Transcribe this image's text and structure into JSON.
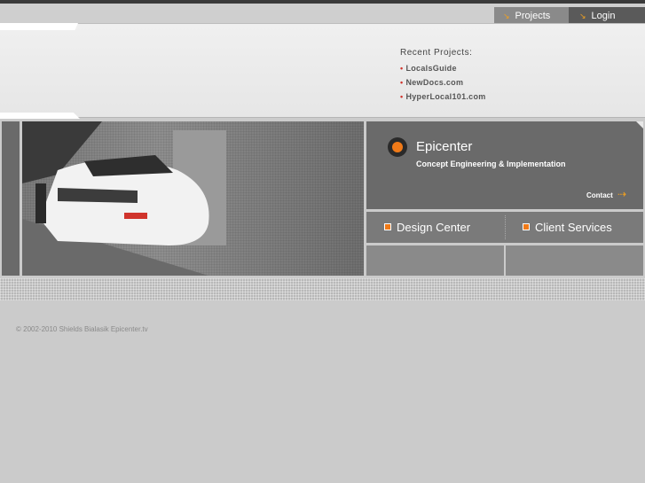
{
  "nav": {
    "projects_label": "Projects",
    "login_label": "Login"
  },
  "recent": {
    "title": "Recent Projects:",
    "items": [
      "LocalsGuide",
      "NewDocs.com",
      "HyperLocal101.com"
    ]
  },
  "epicenter": {
    "title": "Epicenter",
    "subtitle": "Concept Engineering & Implementation",
    "contact_label": "Contact"
  },
  "services": {
    "design_label": "Design Center",
    "client_label": "Client Services"
  },
  "footer": {
    "copyright": "© 2002-2010 Shields Bialasik Epicenter.tv"
  },
  "colors": {
    "accent": "#f07a18",
    "bullet": "#d0342c",
    "panel": "#6a6a6a"
  }
}
